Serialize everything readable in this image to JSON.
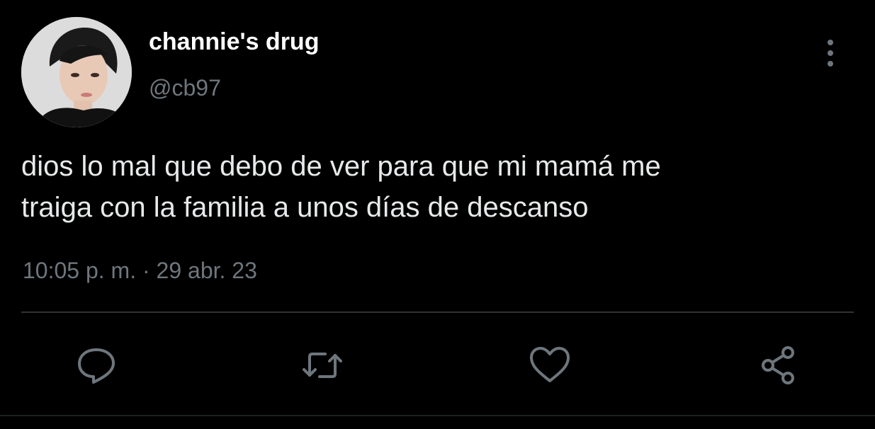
{
  "tweet": {
    "author": {
      "display_name": "channie's drug",
      "handle": "@cb97"
    },
    "text_lines": [
      "dios lo mal que debo de ver para que mi mamá me",
      "traiga con la familia a unos días de descanso"
    ],
    "timestamp": "10:05 p. m. · 29 abr. 23"
  },
  "icons": {
    "more": "more-vertical-icon",
    "reply": "reply-icon",
    "retweet": "retweet-icon",
    "like": "heart-icon",
    "share": "share-icon"
  },
  "colors": {
    "background": "#000000",
    "primary_text": "#e7e9ea",
    "secondary_text": "#6e767d",
    "icon": "#6e767d",
    "divider": "#2f3336"
  }
}
